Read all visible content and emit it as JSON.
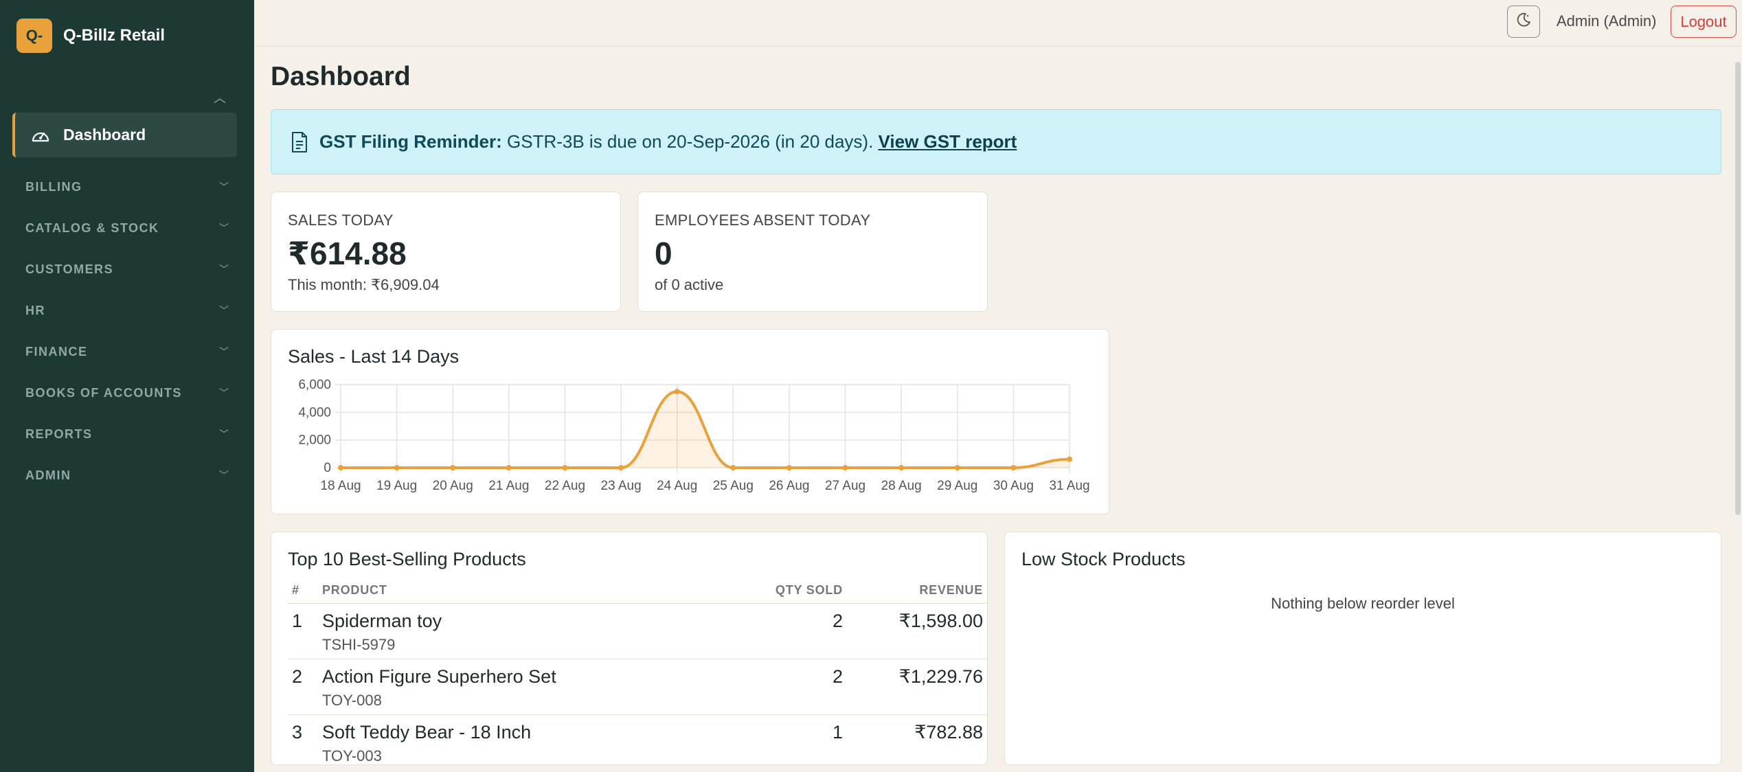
{
  "brand": {
    "logo": "Q-",
    "name": "Q-Billz Retail"
  },
  "sidebar": {
    "active": {
      "label": "Dashboard",
      "icon": "dashboard-gauge-icon"
    },
    "groups": [
      {
        "label": "BILLING"
      },
      {
        "label": "CATALOG & STOCK"
      },
      {
        "label": "CUSTOMERS"
      },
      {
        "label": "HR"
      },
      {
        "label": "FINANCE"
      },
      {
        "label": "BOOKS OF ACCOUNTS"
      },
      {
        "label": "REPORTS"
      },
      {
        "label": "ADMIN"
      }
    ]
  },
  "topbar": {
    "user": "Admin (Admin)",
    "logout": "Logout",
    "theme_icon": "moon-icon"
  },
  "page": {
    "title": "Dashboard"
  },
  "alert": {
    "bold": "GST Filing Reminder:",
    "text": " GSTR-3B is due on 20-Sep-2026 (in 20 days). ",
    "link": "View GST report"
  },
  "stats": {
    "sales": {
      "label": "SALES TODAY",
      "value": "₹614.88",
      "sub": "This month: ₹6,909.04"
    },
    "absent": {
      "label": "EMPLOYEES ABSENT TODAY",
      "value": "0",
      "sub": "of 0 active"
    }
  },
  "chart": {
    "title": "Sales - Last 14 Days"
  },
  "chart_data": {
    "type": "area",
    "title": "Sales - Last 14 Days",
    "categories": [
      "18 Aug",
      "19 Aug",
      "20 Aug",
      "21 Aug",
      "22 Aug",
      "23 Aug",
      "24 Aug",
      "25 Aug",
      "26 Aug",
      "27 Aug",
      "28 Aug",
      "29 Aug",
      "30 Aug",
      "31 Aug"
    ],
    "values": [
      0,
      0,
      0,
      0,
      0,
      0,
      5500,
      0,
      0,
      0,
      0,
      0,
      0,
      615
    ],
    "ylim": [
      0,
      6000
    ],
    "yticks": [
      "0",
      "2,000",
      "4,000",
      "6,000"
    ],
    "grid": true,
    "color": "#e9a23b"
  },
  "top_products": {
    "title": "Top 10 Best-Selling Products",
    "headers": {
      "num": "#",
      "product": "PRODUCT",
      "qty": "QTY SOLD",
      "revenue": "REVENUE"
    },
    "rows": [
      {
        "num": "1",
        "name": "Spiderman toy",
        "sku": "TSHI-5979",
        "qty": "2",
        "revenue": "₹1,598.00"
      },
      {
        "num": "2",
        "name": "Action Figure Superhero Set",
        "sku": "TOY-008",
        "qty": "2",
        "revenue": "₹1,229.76"
      },
      {
        "num": "3",
        "name": "Soft Teddy Bear - 18 Inch",
        "sku": "TOY-003",
        "qty": "1",
        "revenue": "₹782.88"
      }
    ]
  },
  "low_stock": {
    "title": "Low Stock Products",
    "empty": "Nothing below reorder level"
  }
}
